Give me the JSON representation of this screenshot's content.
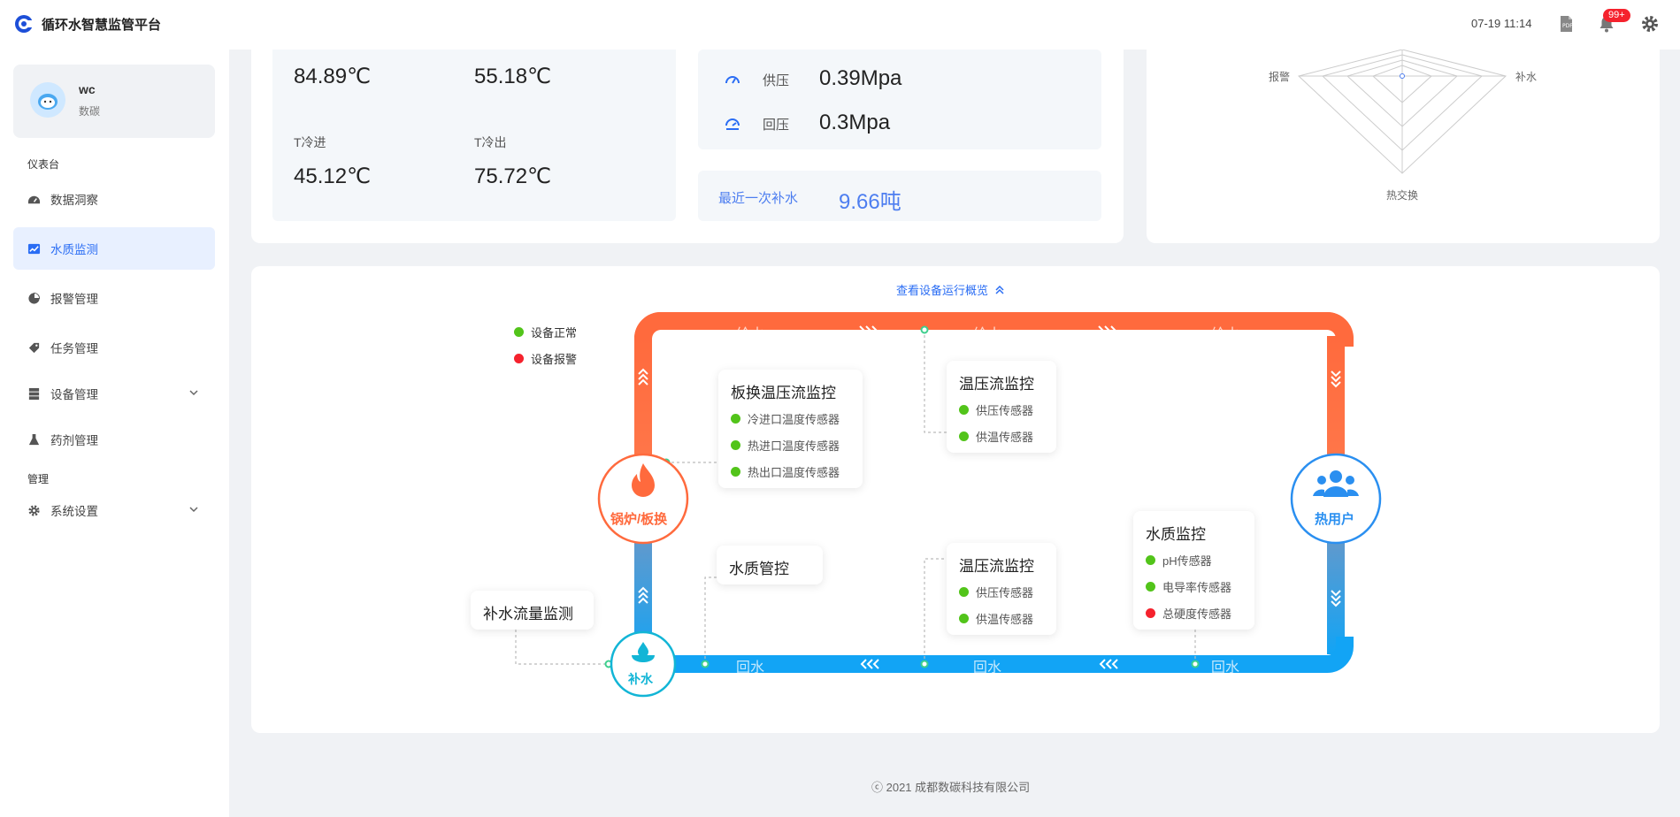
{
  "app": {
    "title": "循环水智慧监管平台"
  },
  "header": {
    "datetime": "07-19 11:14",
    "notification_badge": "99+"
  },
  "user": {
    "name": "wc",
    "org": "数碳"
  },
  "sidebar": {
    "group_dashboard": "仪表台",
    "group_manage": "管理",
    "items": [
      {
        "label": "数据洞察",
        "icon": "dashboard-icon"
      },
      {
        "label": "水质监测",
        "icon": "line-chart-icon",
        "active": true
      },
      {
        "label": "报警管理",
        "icon": "pie-chart-icon"
      },
      {
        "label": "任务管理",
        "icon": "tag-icon"
      },
      {
        "label": "设备管理",
        "icon": "server-icon",
        "expandable": true
      },
      {
        "label": "药剂管理",
        "icon": "flask-icon"
      },
      {
        "label": "系统设置",
        "icon": "gear-icon",
        "expandable": true
      }
    ]
  },
  "temps": {
    "hot_in_val": "84.89℃",
    "hot_out_val": "55.18℃",
    "cold_in_label": "T冷进",
    "cold_in_val": "45.12℃",
    "cold_out_label": "T冷出",
    "cold_out_val": "75.72℃"
  },
  "pressure": {
    "supply_label": "供压",
    "supply_val": "0.39Mpa",
    "return_label": "回压",
    "return_val": "0.3Mpa"
  },
  "makeup": {
    "label": "最近一次补水",
    "value": "9.66吨"
  },
  "radar": {
    "labels": {
      "left": "报警",
      "right": "补水",
      "bottom": "热交换"
    }
  },
  "overview": {
    "toggle_label": "查看设备运行概览",
    "legend": {
      "normal": "设备正常",
      "alarm": "设备报警"
    },
    "pipe_supply": "给水",
    "pipe_return": "回水",
    "boiler_label": "锅炉/板换",
    "user_label": "热用户",
    "makeup_label": "补水",
    "plate_box": {
      "title": "板换温压流监控",
      "sensors": [
        "冷进口温度传感器",
        "热进口温度传感器",
        "热出口温度传感器"
      ]
    },
    "top_box": {
      "title": "温压流监控",
      "sensors": [
        "供压传感器",
        "供温传感器"
      ]
    },
    "quality_ctrl": {
      "title": "水质管控"
    },
    "bottom_box": {
      "title": "温压流监控",
      "sensors": [
        "供压传感器",
        "供温传感器"
      ]
    },
    "quality_box": {
      "title": "水质监控",
      "sensors": [
        "pH传感器",
        "电导率传感器",
        "总硬度传感器"
      ],
      "status": [
        "ok",
        "ok",
        "bad"
      ]
    },
    "flow_box": {
      "title": "补水流量监测"
    }
  },
  "footer": {
    "copyright": "ⓒ 2021 成都数碳科技有限公司"
  },
  "colors": {
    "accent": "#2a6df4",
    "supply_pipe": "#ff6a3d",
    "return_pipe": "#12a4f5",
    "ok": "#52c41a",
    "alarm": "#f5222d"
  }
}
